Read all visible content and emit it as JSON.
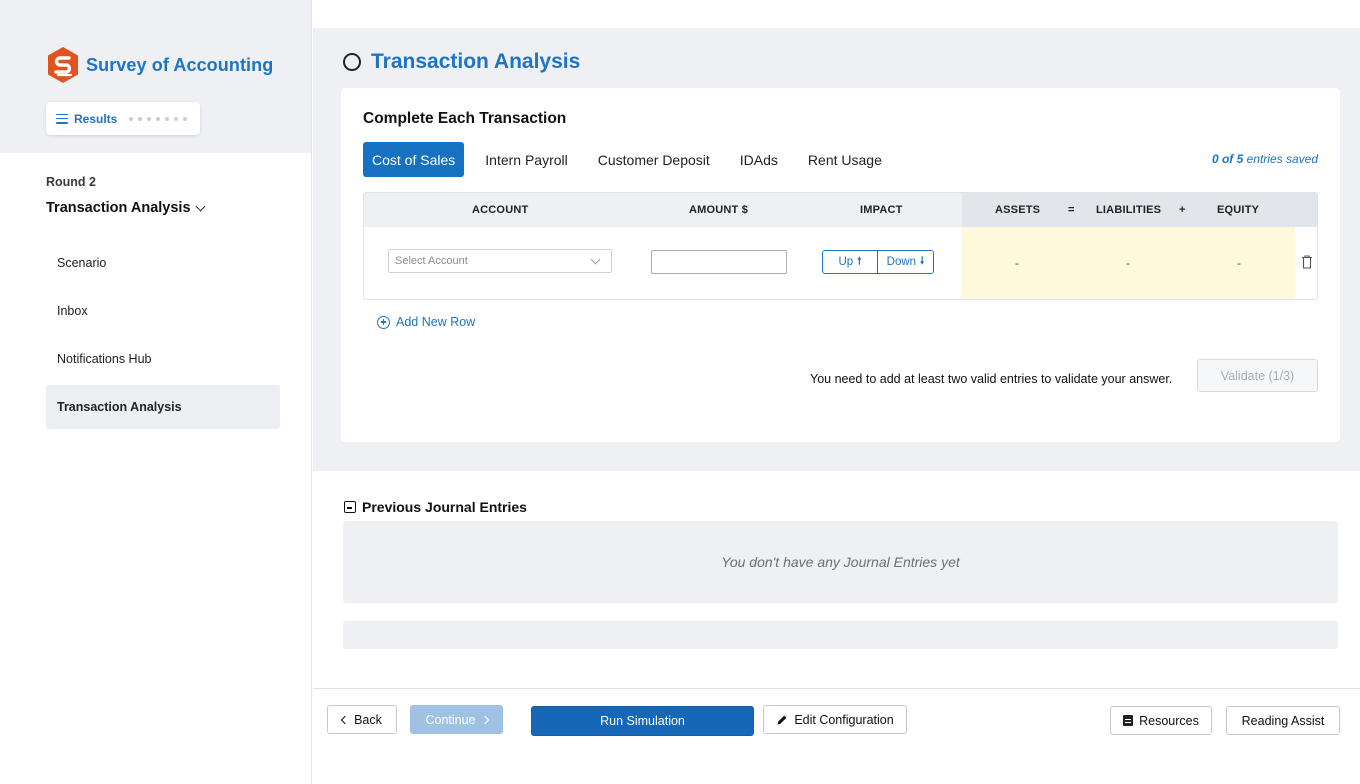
{
  "colors": {
    "accent": "#1d74c4",
    "brand_logo": "#e2541f",
    "run_button": "#1667b8",
    "highlight": "#fef9dc"
  },
  "brand": {
    "name": "Survey of Accounting",
    "logo_icon": "survey-logo-icon"
  },
  "results": {
    "label": "Results"
  },
  "sidebar": {
    "round_label": "Round 2",
    "section_title": "Transaction Analysis",
    "items": [
      {
        "label": "Scenario"
      },
      {
        "label": "Inbox"
      },
      {
        "label": "Notifications Hub"
      },
      {
        "label": "Transaction Analysis"
      }
    ]
  },
  "page": {
    "title": "Transaction Analysis"
  },
  "card": {
    "title": "Complete Each Transaction",
    "tabs": [
      {
        "label": "Cost of Sales"
      },
      {
        "label": "Intern Payroll"
      },
      {
        "label": "Customer Deposit"
      },
      {
        "label": "IDAds"
      },
      {
        "label": "Rent Usage"
      }
    ],
    "entries_saved": {
      "count": "0 of 5",
      "suffix": "entries saved"
    }
  },
  "table": {
    "headers": {
      "account": "ACCOUNT",
      "amount": "AMOUNT $",
      "impact": "IMPACT",
      "assets": "ASSETS",
      "eq": "=",
      "liabilities": "LIABILITIES",
      "plus": "+",
      "equity": "EQUITY"
    },
    "row": {
      "account_placeholder": "Select Account",
      "amount_value": "",
      "impact_up": "Up",
      "impact_down": "Down",
      "assets": "-",
      "liabilities": "-",
      "equity": "-"
    }
  },
  "add_row": {
    "label": "Add New Row"
  },
  "validation": {
    "message": "You need to add at least two valid entries to validate your answer.",
    "button": "Validate (1/3)"
  },
  "previous": {
    "title": "Previous Journal Entries",
    "empty_text": "You don't have any Journal Entries yet"
  },
  "footer": {
    "back": "Back",
    "continue": "Continue",
    "run": "Run Simulation",
    "edit": "Edit Configuration",
    "resources": "Resources",
    "reading_assist": "Reading Assist"
  }
}
